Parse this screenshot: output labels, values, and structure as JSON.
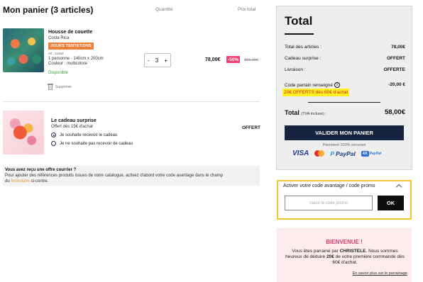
{
  "cart": {
    "title": "Mon panier (3 articles)",
    "col_quantity": "Quantité",
    "col_total": "Prix total"
  },
  "item1": {
    "name": "Housse de couette",
    "collection": "Costa Rica",
    "badge": "JOURS TENTATIONS",
    "ref": "réf : 31654",
    "desc1": "1 personne - 140cm x 200cm",
    "desc2": "Couleur : multicolore",
    "availability": "Disponible",
    "remove": "Supprimer",
    "quantity": "3",
    "minus": "-",
    "plus": "+",
    "price_now": "78,00€",
    "discount": "-50%",
    "price_old": "156,00€"
  },
  "item2": {
    "name": "Le cadeau surprise",
    "sub": "Offert dès 15€ d'achat",
    "price": "OFFERT",
    "option_yes": "Je souhaite recevoir le cadeau",
    "option_no": "Je ne souhaite pas recevoir de cadeau"
  },
  "info": {
    "title": "Vous avez reçu une offre courrier ?",
    "text": "Pour ajouter des références produits issues de votre catalogue, activez d'abord votre code avantage dans le champ",
    "text_du": "du",
    "link": "formulaire",
    "text_end": "ci-contre."
  },
  "summary": {
    "title": "Total",
    "rows": [
      {
        "label": "Total des articles :",
        "value": "78,00€"
      },
      {
        "label": "Cadeau surprise :",
        "value": "OFFERT"
      },
      {
        "label": "Livraison :",
        "value": "OFFERTE"
      }
    ],
    "code_label": "Code parrain renseigné",
    "code_value": "-20,00 €",
    "offer_highlight": "20€ OFFERTS dès 60€ d'achat",
    "grand_label": "Total",
    "grand_tax": "(TVA incluse) :",
    "grand_value": "58,00€",
    "validate": "VALIDER MON PANIER",
    "secure": "Paiement 100% sécurisé",
    "payments": {
      "visa": "VISA",
      "paypal": "PayPal",
      "x4": "4X",
      "x4_pp": "PayPal"
    }
  },
  "promo": {
    "title": "Activer votre code avantage / code promo",
    "placeholder": "Saisir le code promo",
    "ok": "OK"
  },
  "welcome": {
    "title": "BIENVENUE !",
    "line1": "Vous êtes parrainé par",
    "sponsor": "CHRISTELE",
    "line2": ". Nous sommes heureux de déduire",
    "amount": "20€",
    "line3": "de votre première commande dès 60€ d'achat.",
    "link": "En savoir plus sur le parrainage"
  },
  "colors": {
    "navy_button": "#16233f",
    "badge_orange": "#e8823a",
    "discount_pink": "#e8426d",
    "highlight_yellow": "#fff021",
    "offer_red": "#d2241b",
    "welcome_pink": "#e23b6a",
    "promo_border": "#f2c533"
  }
}
